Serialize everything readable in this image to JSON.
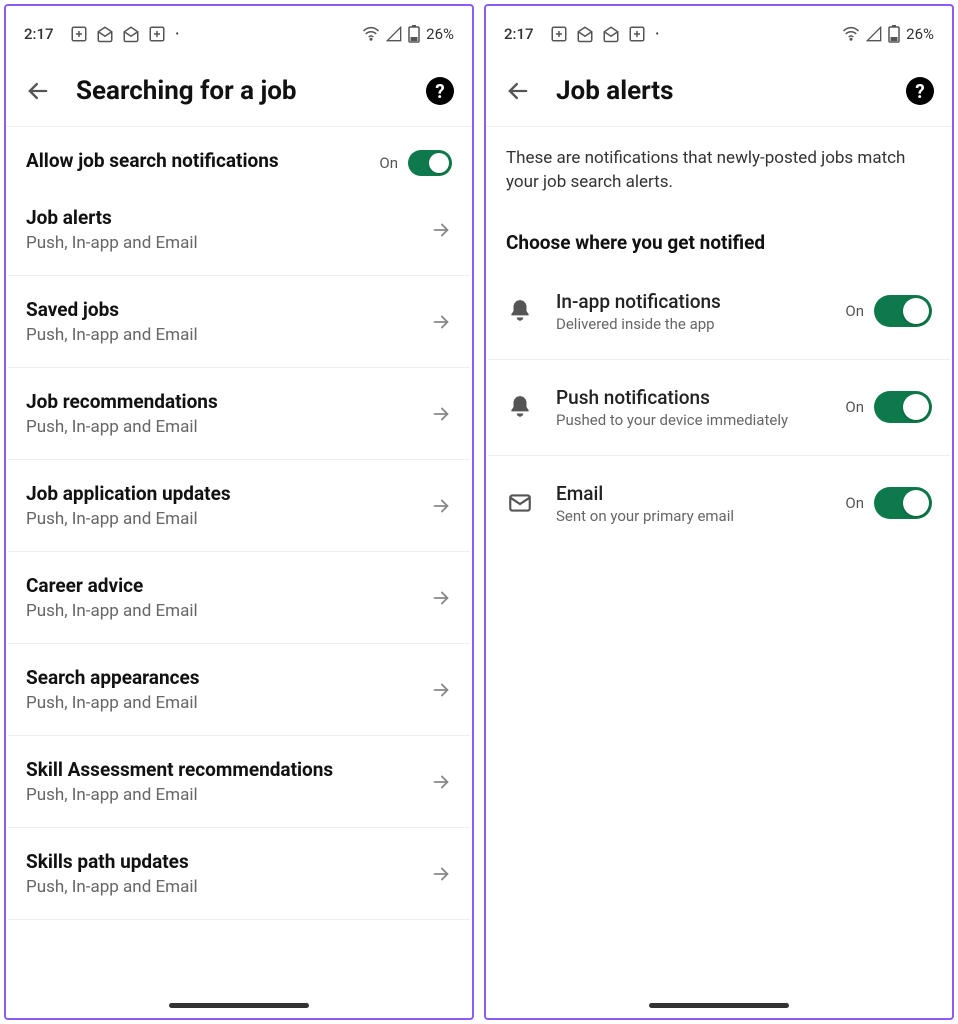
{
  "status": {
    "time": "2:17",
    "battery": "26%"
  },
  "left": {
    "title": "Searching for a job",
    "allowNotifications": {
      "label": "Allow job search notifications",
      "state": "On"
    },
    "items": [
      {
        "title": "Job alerts",
        "sub": "Push, In-app and Email"
      },
      {
        "title": "Saved jobs",
        "sub": "Push, In-app and Email"
      },
      {
        "title": "Job recommendations",
        "sub": "Push, In-app and Email"
      },
      {
        "title": "Job application updates",
        "sub": "Push, In-app and Email"
      },
      {
        "title": "Career advice",
        "sub": "Push, In-app and Email"
      },
      {
        "title": "Search appearances",
        "sub": "Push, In-app and Email"
      },
      {
        "title": "Skill Assessment recommendations",
        "sub": "Push, In-app and Email"
      },
      {
        "title": "Skills path updates",
        "sub": "Push, In-app and Email"
      }
    ]
  },
  "right": {
    "title": "Job alerts",
    "intro": "These are notifications that newly-posted jobs match your job search alerts.",
    "sectionHeading": "Choose where you get notified",
    "channels": [
      {
        "title": "In-app notifications",
        "sub": "Delivered inside the app",
        "state": "On",
        "icon": "bell"
      },
      {
        "title": "Push notifications",
        "sub": "Pushed to your device immediately",
        "state": "On",
        "icon": "bell"
      },
      {
        "title": "Email",
        "sub": "Sent on your primary email",
        "state": "On",
        "icon": "mail"
      }
    ]
  }
}
